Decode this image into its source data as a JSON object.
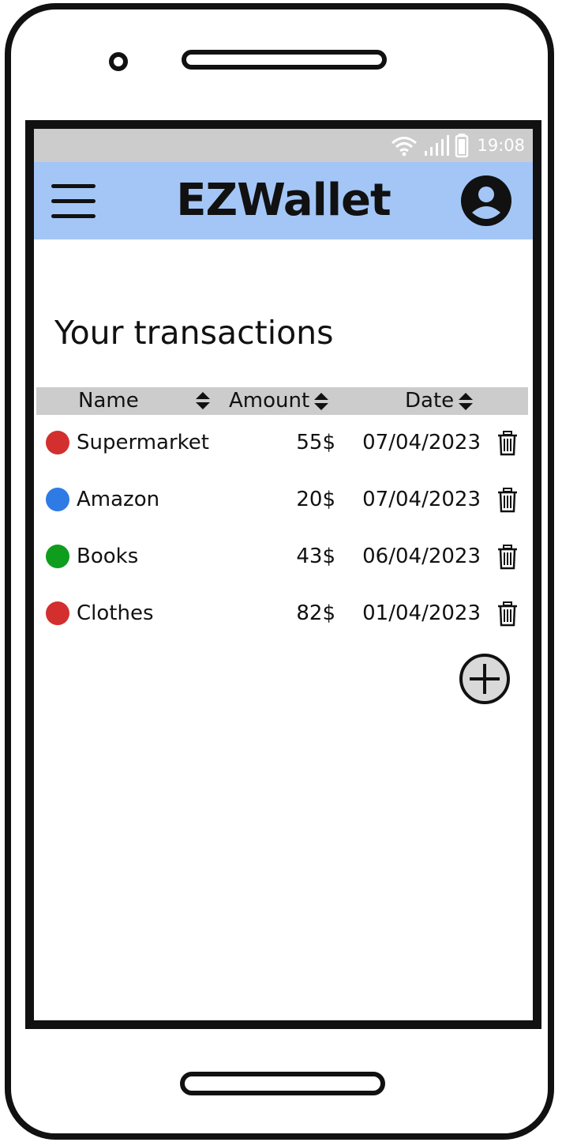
{
  "status_bar": {
    "time": "19:08",
    "icons": [
      "wifi-icon",
      "signal-icon",
      "battery-icon"
    ],
    "background": "#cccccc"
  },
  "app_bar": {
    "title": "EZWallet",
    "background": "#a3c6f7",
    "left_icon": "menu-icon",
    "right_icon": "account-icon"
  },
  "page": {
    "title": "Your transactions"
  },
  "table": {
    "headers": {
      "name": "Name",
      "amount": "Amount",
      "date": "Date"
    },
    "header_background": "#cccccc",
    "rows": [
      {
        "category_color": "#d32f2f",
        "name": "Supermarket",
        "amount": "55$",
        "date": "07/04/2023"
      },
      {
        "category_color": "#2f7be6",
        "name": "Amazon",
        "amount": "20$",
        "date": "07/04/2023"
      },
      {
        "category_color": "#0f9d1e",
        "name": "Books",
        "amount": "43$",
        "date": "06/04/2023"
      },
      {
        "category_color": "#d32f2f",
        "name": "Clothes",
        "amount": "82$",
        "date": "01/04/2023"
      }
    ]
  },
  "actions": {
    "row_action_icon": "trash-icon",
    "add_icon": "plus-circle-icon"
  }
}
